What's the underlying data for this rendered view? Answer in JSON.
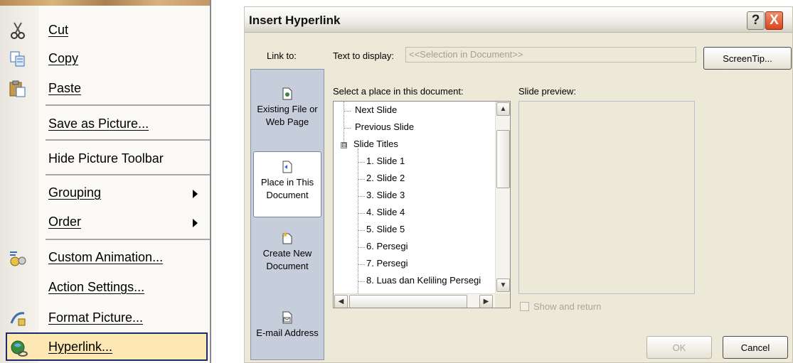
{
  "context_menu": {
    "items": [
      {
        "label": "Cut",
        "icon": "scissors-icon"
      },
      {
        "label": "Copy",
        "icon": "copy-icon"
      },
      {
        "label": "Paste",
        "icon": "paste-icon"
      },
      {
        "label": "Save as Picture...",
        "icon": ""
      },
      {
        "label": "Hide Picture Toolbar",
        "icon": ""
      },
      {
        "label": "Grouping",
        "icon": "",
        "submenu": true
      },
      {
        "label": "Order",
        "icon": "",
        "submenu": true
      },
      {
        "label": "Custom Animation...",
        "icon": "custom-animation-icon"
      },
      {
        "label": "Action Settings...",
        "icon": ""
      },
      {
        "label": "Format Picture...",
        "icon": "format-picture-icon"
      },
      {
        "label": "Hyperlink...",
        "icon": "hyperlink-icon",
        "highlighted": true
      }
    ]
  },
  "dialog": {
    "title": "Insert Hyperlink",
    "help_glyph": "?",
    "close_glyph": "X",
    "link_to_label": "Link to:",
    "text_to_display_label": "Text to display:",
    "text_to_display_value": "<<Selection in Document>>",
    "screentip_label": "ScreenTip...",
    "link_options": [
      {
        "label": "Existing File or\nWeb Page",
        "icon": "existing-file-icon"
      },
      {
        "label": "Place in This\nDocument",
        "icon": "place-in-document-icon",
        "selected": true
      },
      {
        "label": "Create New\nDocument",
        "icon": "new-document-icon"
      },
      {
        "label": "E-mail Address",
        "icon": "email-address-icon"
      }
    ],
    "select_place_label": "Select a place in this document:",
    "tree": {
      "top_items": [
        "Next Slide",
        "Previous Slide",
        "Slide Titles"
      ],
      "toggle_glyph": "⊟",
      "slides": [
        "1. Slide 1",
        "2. Slide 2",
        "3. Slide 3",
        "4. Slide 4",
        "5. Slide 5",
        "6. Persegi",
        "7. Persegi",
        "8. Luas dan Keliling Persegi"
      ]
    },
    "slide_preview_label": "Slide preview:",
    "show_and_return_label": "Show and return",
    "ok_label": "OK",
    "cancel_label": "Cancel",
    "scroll_glyphs": {
      "up": "▲",
      "down": "▼",
      "left": "◀",
      "right": "▶"
    }
  }
}
